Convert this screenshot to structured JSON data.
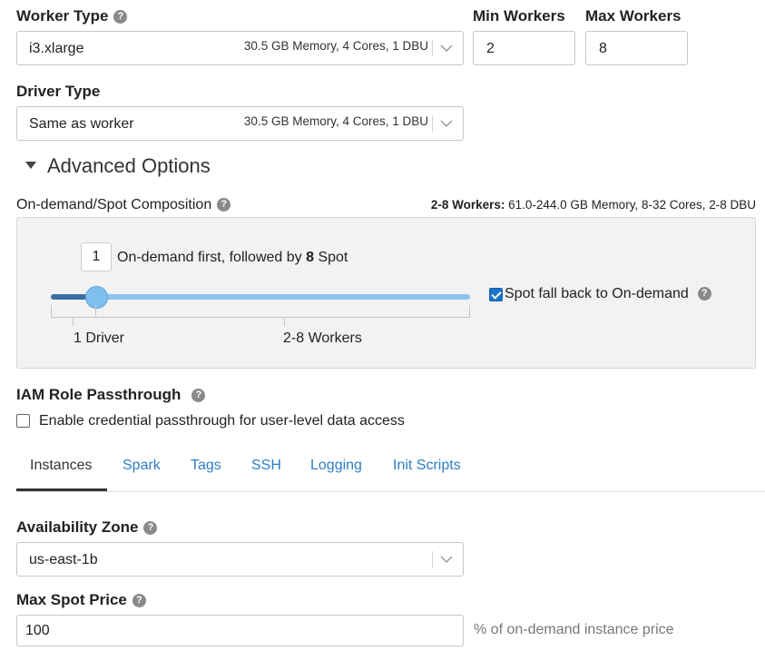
{
  "worker_type": {
    "label": "Worker Type",
    "value": "i3.xlarge",
    "desc": "30.5 GB Memory, 4 Cores, 1 DBU"
  },
  "min_workers": {
    "label": "Min Workers",
    "value": "2"
  },
  "max_workers": {
    "label": "Max Workers",
    "value": "8"
  },
  "driver_type": {
    "label": "Driver Type",
    "value": "Same as worker",
    "desc": "30.5 GB Memory, 4 Cores, 1 DBU"
  },
  "advanced": {
    "title": "Advanced Options"
  },
  "composition": {
    "label": "On-demand/Spot Composition",
    "summary_bold": "2-8 Workers:",
    "summary_rest": " 61.0-244.0 GB Memory, 8-32 Cores, 2-8 DBU",
    "on_demand_count": "1",
    "on_demand_text_pre": "On-demand first, followed by ",
    "spot_count": "8",
    "on_demand_text_post": " Spot",
    "slider_fraction": 0.11,
    "tick_driver": "1 Driver",
    "tick_workers": "2-8 Workers",
    "spot_fallback_label": "Spot fall back to On-demand",
    "spot_fallback_checked": true
  },
  "iam": {
    "label": "IAM Role Passthrough",
    "checkbox_label": "Enable credential passthrough for user-level data access",
    "checked": false
  },
  "tabs": [
    {
      "label": "Instances",
      "active": true
    },
    {
      "label": "Spark"
    },
    {
      "label": "Tags"
    },
    {
      "label": "SSH"
    },
    {
      "label": "Logging"
    },
    {
      "label": "Init Scripts"
    }
  ],
  "availability_zone": {
    "label": "Availability Zone",
    "value": "us-east-1b"
  },
  "max_spot_price": {
    "label": "Max Spot Price",
    "value": "100",
    "suffix": "% of on-demand instance price"
  },
  "icons": {
    "help": "question-circle-icon",
    "chevron": "chevron-down-icon",
    "caret": "caret-down-icon"
  },
  "colors": {
    "link": "#2c7ec4",
    "slider_fill": "#3a6ea5",
    "slider_track": "#8cc4ee",
    "checkbox": "#1a73c9"
  }
}
